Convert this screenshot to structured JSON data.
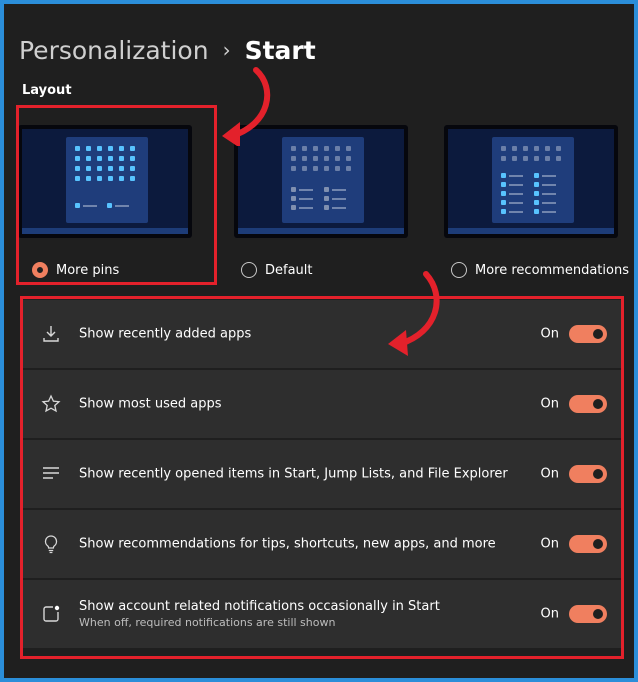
{
  "breadcrumb": {
    "parent": "Personalization",
    "separator": "›",
    "current": "Start"
  },
  "layout": {
    "label": "Layout",
    "options": [
      {
        "label": "More pins",
        "selected": true
      },
      {
        "label": "Default",
        "selected": false
      },
      {
        "label": "More recommendations",
        "selected": false
      }
    ]
  },
  "settings": [
    {
      "icon": "download-icon",
      "title": "Show recently added apps",
      "subtitle": "",
      "state": "On",
      "enabled": true
    },
    {
      "icon": "star-icon",
      "title": "Show most used apps",
      "subtitle": "",
      "state": "On",
      "enabled": true
    },
    {
      "icon": "list-icon",
      "title": "Show recently opened items in Start, Jump Lists, and File Explorer",
      "subtitle": "",
      "state": "On",
      "enabled": true
    },
    {
      "icon": "lightbulb-icon",
      "title": "Show recommendations for tips, shortcuts, new apps, and more",
      "subtitle": "",
      "state": "On",
      "enabled": true
    },
    {
      "icon": "notification-icon",
      "title": "Show account related notifications occasionally in Start",
      "subtitle": "When off, required notifications are still shown",
      "state": "On",
      "enabled": true
    }
  ],
  "colors": {
    "accent": "#f07f5f",
    "annotation": "#e3212b",
    "page_bg": "#1f1f1f",
    "card_bg": "#2e2e2e",
    "frame": "#2b8ed9"
  }
}
